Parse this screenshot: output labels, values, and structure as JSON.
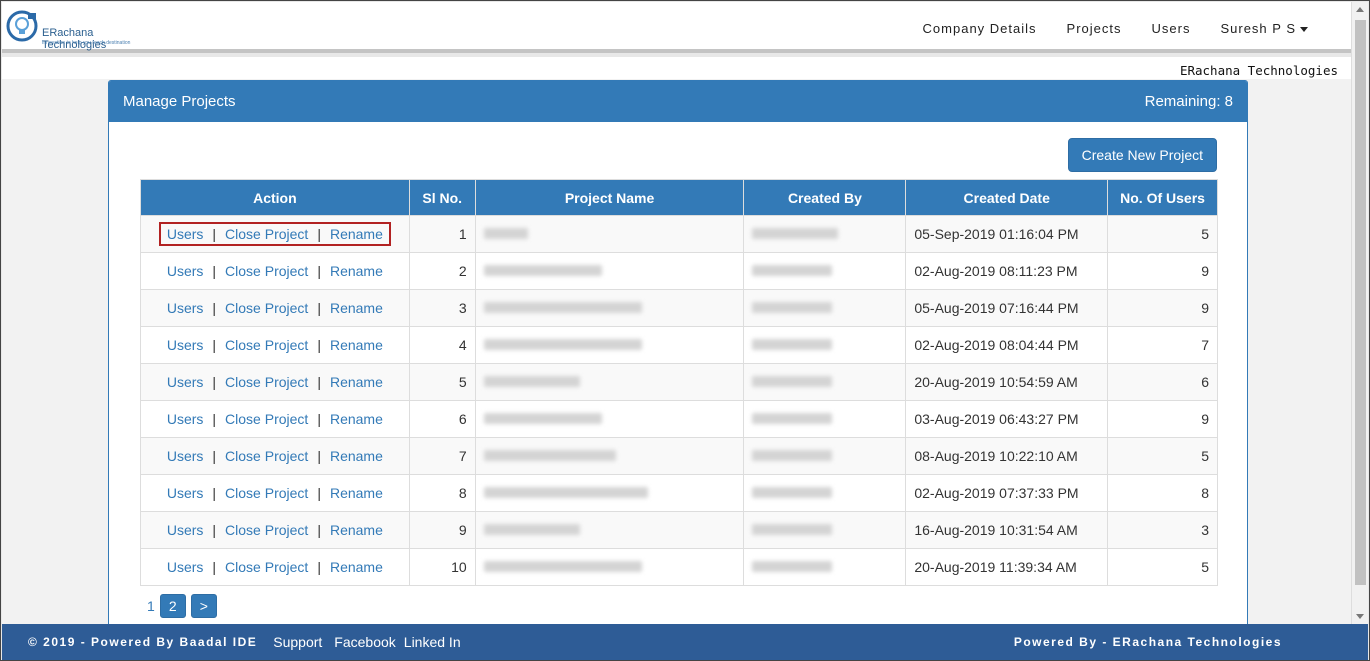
{
  "brand": {
    "name": "ERachana Technologies",
    "tagline": "Innovation to help you reach destination"
  },
  "nav": {
    "items": [
      "Company Details",
      "Projects",
      "Users"
    ],
    "user": "Suresh P S"
  },
  "org_label": "ERachana Technologies",
  "panel": {
    "title": "Manage Projects",
    "remaining": "Remaining: 8",
    "create_label": "Create New Project"
  },
  "table": {
    "headers": [
      "Action",
      "Sl No.",
      "Project Name",
      "Created By",
      "Created Date",
      "No. Of Users"
    ],
    "action_labels": {
      "users": "Users",
      "close": "Close Project",
      "rename": "Rename",
      "sep": "|"
    },
    "rows": [
      {
        "sl": "1",
        "date": "05-Sep-2019 01:16:04 PM",
        "users": "5"
      },
      {
        "sl": "2",
        "date": "02-Aug-2019 08:11:23 PM",
        "users": "9"
      },
      {
        "sl": "3",
        "date": "05-Aug-2019 07:16:44 PM",
        "users": "9"
      },
      {
        "sl": "4",
        "date": "02-Aug-2019 08:04:44 PM",
        "users": "7"
      },
      {
        "sl": "5",
        "date": "20-Aug-2019 10:54:59 AM",
        "users": "6"
      },
      {
        "sl": "6",
        "date": "03-Aug-2019 06:43:27 PM",
        "users": "9"
      },
      {
        "sl": "7",
        "date": "08-Aug-2019 10:22:10 AM",
        "users": "5"
      },
      {
        "sl": "8",
        "date": "02-Aug-2019 07:37:33 PM",
        "users": "8"
      },
      {
        "sl": "9",
        "date": "16-Aug-2019 10:31:54 AM",
        "users": "3"
      },
      {
        "sl": "10",
        "date": "20-Aug-2019 11:39:34 AM",
        "users": "5"
      }
    ]
  },
  "pager": {
    "current": "1",
    "next_page": "2",
    "next_label": ">"
  },
  "footer": {
    "left": "© 2019 - Powered By Baadal IDE",
    "links": [
      "Support",
      "Facebook",
      "Linked In"
    ],
    "right": "Powered By - ERachana Technologies"
  }
}
